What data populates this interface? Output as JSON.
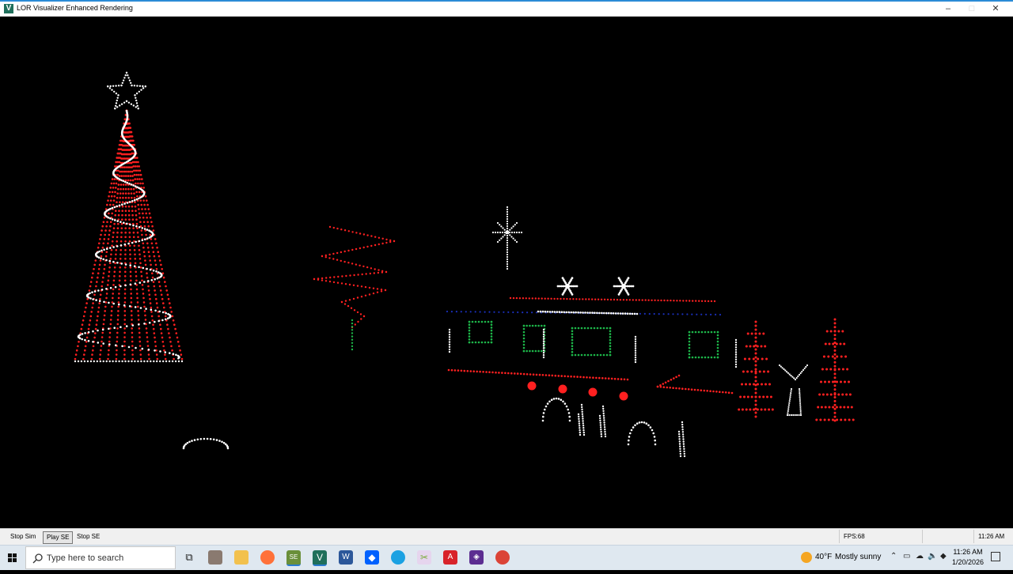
{
  "window": {
    "title": "LOR Visualizer Enhanced Rendering",
    "minimize": "–",
    "maximize": "□",
    "close": "✕"
  },
  "colors": {
    "red": "#ff2020",
    "white": "#ffffff",
    "green": "#1db84a",
    "blue": "#1a2fb8"
  },
  "statusbar": {
    "stop_sim": "Stop Sim",
    "play_se": "Play SE",
    "stop_se": "Stop SE",
    "fps": "FPS:68",
    "time": "11:26 AM"
  },
  "taskbar": {
    "search_placeholder": "Type here to search",
    "weather_temp": "40°F",
    "weather_condition": "Mostly sunny",
    "clock_time": "11:26 AM",
    "clock_date": "1/20/2026",
    "pinned_icons": [
      "task-view-icon",
      "app-icon-1",
      "file-explorer-icon",
      "firefox-icon",
      "superstar-icon",
      "lor-visualizer-icon",
      "word-icon",
      "dropbox-icon",
      "edge-icon",
      "snipping-icon",
      "acrobat-icon",
      "visual-studio-icon",
      "chrome-icon"
    ]
  }
}
